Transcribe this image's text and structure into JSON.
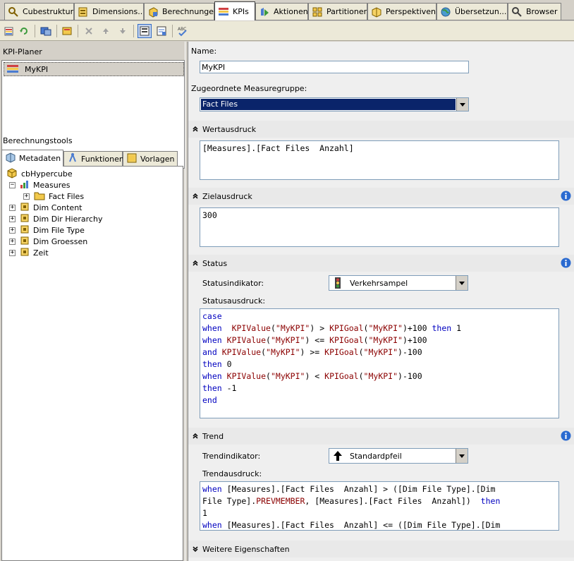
{
  "tabs": [
    {
      "label": "Cubestruktur",
      "icon": "cube-structure-icon"
    },
    {
      "label": "Dimensions...",
      "icon": "dimension-usage-icon"
    },
    {
      "label": "Berechnungen",
      "icon": "calculations-icon"
    },
    {
      "label": "KPIs",
      "icon": "kpi-icon",
      "active": true
    },
    {
      "label": "Aktionen",
      "icon": "actions-icon"
    },
    {
      "label": "Partitionen",
      "icon": "partitions-icon"
    },
    {
      "label": "Perspektiven",
      "icon": "perspectives-icon"
    },
    {
      "label": "Übersetzun...",
      "icon": "globe-icon"
    },
    {
      "label": "Browser",
      "icon": "browser-icon"
    }
  ],
  "left": {
    "kpi_planner_title": "KPI-Planer",
    "kpi_item": "MyKPI",
    "calc_tools_title": "Berechnungstools",
    "subtabs": [
      "Metadaten",
      "Funktionen",
      "Vorlagen"
    ],
    "tree": {
      "root": "cbHypercube",
      "measures": "Measures",
      "fact_files": "Fact Files",
      "dims": [
        "Dim Content",
        "Dim Dir Hierarchy",
        "Dim File Type",
        "Dim Groessen",
        "Zeit"
      ]
    }
  },
  "form": {
    "name_label": "Name:",
    "name_value": "MyKPI",
    "measure_group_label": "Zugeordnete Measuregruppe:",
    "measure_group_value": "Fact Files",
    "value_expr_title": "Wertausdruck",
    "value_expr": "[Measures].[Fact Files  Anzahl]",
    "goal_expr_title": "Zielausdruck",
    "goal_expr": "300",
    "status_title": "Status",
    "status_indicator_label": "Statusindikator:",
    "status_indicator_value": "Verkehrsampel",
    "status_expr_label": "Statusausdruck:",
    "status_lines": [
      [
        [
          "kw",
          "case"
        ]
      ],
      [
        [
          "kw",
          "when"
        ],
        [
          "t",
          "  "
        ],
        [
          "fn",
          "KPIValue"
        ],
        [
          "t",
          "("
        ],
        [
          "st",
          "\"MyKPI\""
        ],
        [
          "t",
          ") > "
        ],
        [
          "fn",
          "KPIGoal"
        ],
        [
          "t",
          "("
        ],
        [
          "st",
          "\"MyKPI\""
        ],
        [
          "t",
          ")+100 "
        ],
        [
          "kw",
          "then"
        ],
        [
          "t",
          " 1"
        ]
      ],
      [
        [
          "kw",
          "when"
        ],
        [
          "t",
          " "
        ],
        [
          "fn",
          "KPIValue"
        ],
        [
          "t",
          "("
        ],
        [
          "st",
          "\"MyKPI\""
        ],
        [
          "t",
          ") <= "
        ],
        [
          "fn",
          "KPIGoal"
        ],
        [
          "t",
          "("
        ],
        [
          "st",
          "\"MyKPI\""
        ],
        [
          "t",
          ")+100"
        ]
      ],
      [
        [
          "kw",
          "and"
        ],
        [
          "t",
          " "
        ],
        [
          "fn",
          "KPIValue"
        ],
        [
          "t",
          "("
        ],
        [
          "st",
          "\"MyKPI\""
        ],
        [
          "t",
          ") >= "
        ],
        [
          "fn",
          "KPIGoal"
        ],
        [
          "t",
          "("
        ],
        [
          "st",
          "\"MyKPI\""
        ],
        [
          "t",
          ")-100"
        ]
      ],
      [
        [
          "kw",
          "then"
        ],
        [
          "t",
          " 0"
        ]
      ],
      [
        [
          "kw",
          "when"
        ],
        [
          "t",
          " "
        ],
        [
          "fn",
          "KPIValue"
        ],
        [
          "t",
          "("
        ],
        [
          "st",
          "\"MyKPI\""
        ],
        [
          "t",
          ") < "
        ],
        [
          "fn",
          "KPIGoal"
        ],
        [
          "t",
          "("
        ],
        [
          "st",
          "\"MyKPI\""
        ],
        [
          "t",
          ")-100"
        ]
      ],
      [
        [
          "kw",
          "then"
        ],
        [
          "t",
          " -1"
        ]
      ],
      [
        [
          "kw",
          "end"
        ]
      ]
    ],
    "trend_title": "Trend",
    "trend_indicator_label": "Trendindikator:",
    "trend_indicator_value": "Standardpfeil",
    "trend_expr_label": "Trendausdruck:",
    "trend_lines": [
      [
        [
          "kw",
          "when"
        ],
        [
          "t",
          " [Measures].[Fact Files  Anzahl] > ([Dim File Type].[Dim"
        ]
      ],
      [
        [
          "t",
          "File Type]."
        ],
        [
          "fn",
          "PREVMEMBER"
        ],
        [
          "t",
          ", [Measures].[Fact Files  Anzahl])  "
        ],
        [
          "kw",
          "then"
        ]
      ],
      [
        [
          "t",
          "1"
        ]
      ],
      [
        [
          "kw",
          "when"
        ],
        [
          "t",
          " [Measures].[Fact Files  Anzahl] <= ([Dim File Type].[Dim"
        ]
      ]
    ],
    "more_props_title": "Weitere Eigenschaften"
  },
  "colors": {
    "keyword": "#0000c0",
    "function": "#8b0000",
    "selection": "#0a246a"
  }
}
